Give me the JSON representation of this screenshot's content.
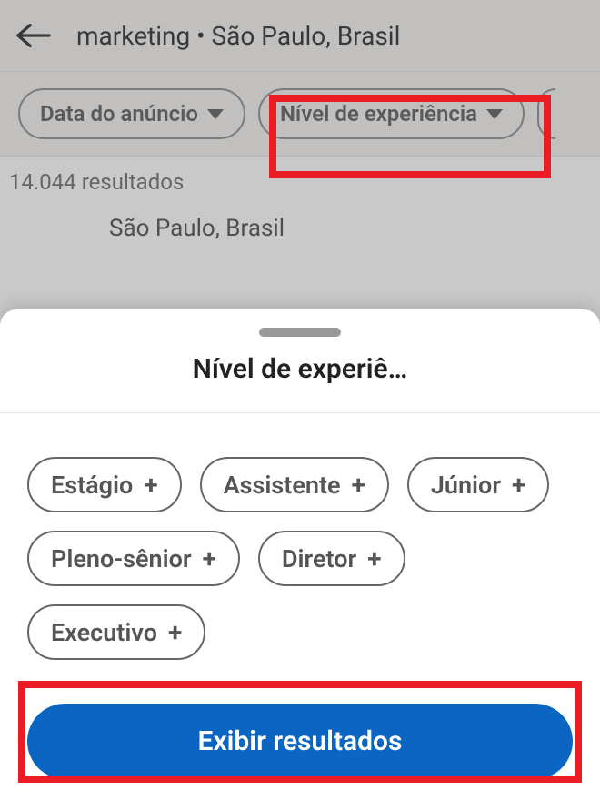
{
  "header": {
    "search_title": "marketing • São Paulo, Brasil"
  },
  "filters": {
    "date_posted_label": "Data do anúncio",
    "experience_level_label": "Nível de experiência"
  },
  "results": {
    "count_text": "14.044 resultados",
    "location_text": "São Paulo, Brasil"
  },
  "sheet": {
    "title": "Nível de experiê…",
    "options": {
      "internship": "Estágio",
      "assistant": "Assistente",
      "junior": "Júnior",
      "mid_senior": "Pleno-sênior",
      "director": "Diretor",
      "executive": "Executivo"
    },
    "show_results_label": "Exibir resultados"
  }
}
